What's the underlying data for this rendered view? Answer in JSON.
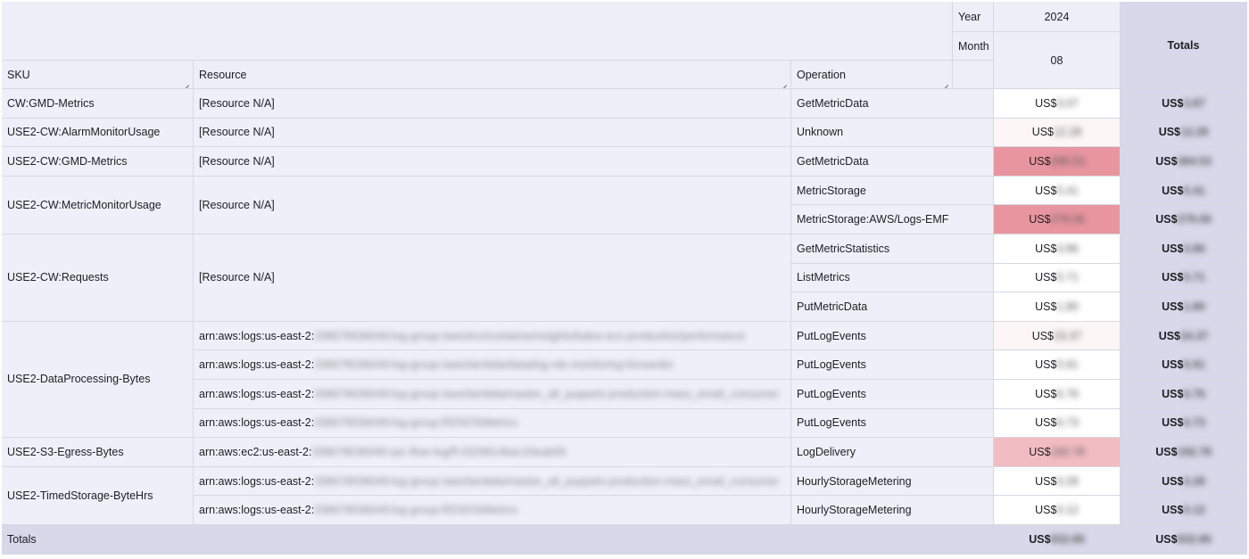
{
  "header": {
    "year_label": "Year",
    "year_value": "2024",
    "month_label": "Month",
    "month_value": "08",
    "totals_label": "Totals",
    "sku_label": "SKU",
    "resource_label": "Resource",
    "operation_label": "Operation"
  },
  "currency": "US$",
  "skus": [
    "CW:GMD-Metrics",
    "USE2-CW:AlarmMonitorUsage",
    "USE2-CW:GMD-Metrics",
    "USE2-CW:MetricMonitorUsage",
    "USE2-CW:Requests",
    "USE2-DataProcessing-Bytes",
    "USE2-S3-Egress-Bytes",
    "USE2-TimedStorage-ByteHrs"
  ],
  "resource_na": "[Resource N/A]",
  "resource_prefix_logs": "arn:aws:logs:us-east-2:",
  "resource_prefix_ec2": "arn:aws:ec2:us-east-2:",
  "resource_blurred": [
    "338678036049:log-group:/aws/ecs/containerinsights/batos-ecs-production/performance",
    "338678036049:log-group:/aws/lambda/datadog-rds-monitoring-forwarder",
    "338678036049:log-group:/aws/lambda/master_all_puppets-production-mass_email_consumer",
    "338678036049:log-group:RDSOSMetrics",
    "338678036049:vpc-flow-log/fl-0329614bac33eab06",
    "338678036049:log-group:/aws/lambda/master_all_puppets-production-mass_email_consumer",
    "338678036049:log-group:RDSOSMetrics"
  ],
  "operations": [
    "GetMetricData",
    "Unknown",
    "GetMetricData",
    "MetricStorage",
    "MetricStorage:AWS/Logs-EMF",
    "GetMetricStatistics",
    "ListMetrics",
    "PutMetricData",
    "PutLogEvents",
    "PutLogEvents",
    "PutLogEvents",
    "PutLogEvents",
    "LogDelivery",
    "HourlyStorageMetering",
    "HourlyStorageMetering"
  ],
  "month_values": [
    "3.07",
    "12.28",
    "288.53",
    "5.41",
    "279.06",
    "3.86",
    "5.71",
    "1.80",
    "23.37",
    "5.91",
    "6.76",
    "6.73",
    "192.78",
    "3.28",
    "0.12"
  ],
  "total_values": [
    "3.87",
    "12.28",
    "384.53",
    "5.41",
    "279.06",
    "3.86",
    "5.71",
    "1.80",
    "24.37",
    "5.91",
    "6.76",
    "6.73",
    "192.78",
    "3.28",
    "0.12"
  ],
  "grand_total_month": "832.86",
  "grand_total_all": "832.86",
  "grand_totals_label": "Totals",
  "colors": {
    "header_bg": "#eceef8",
    "totals_bg": "#d7d9ea",
    "heat_high": "#e8959f",
    "heat_mid": "#f2bcc3",
    "heat_low": "#fcf6f7",
    "border": "#d6d8e2"
  }
}
